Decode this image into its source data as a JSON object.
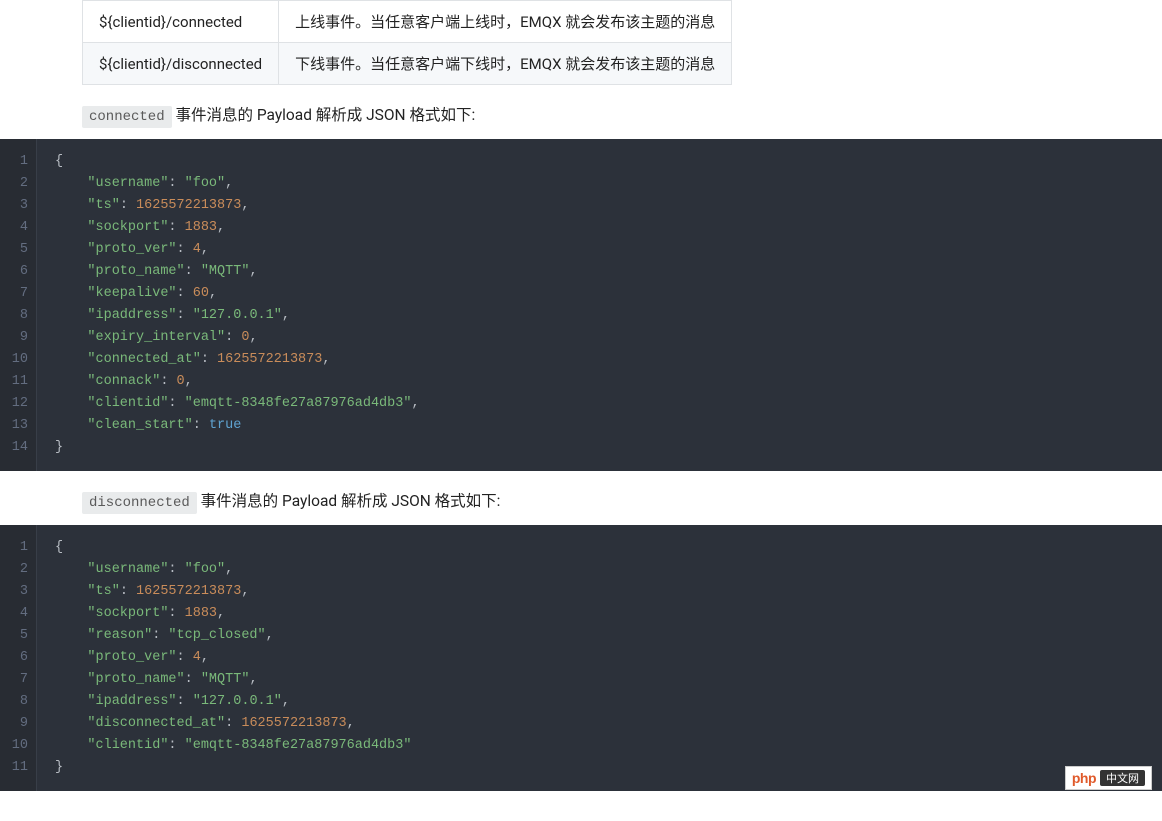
{
  "table": {
    "rows": [
      {
        "topic": "${clientid}/connected",
        "desc": "上线事件。当任意客户端上线时，EMQX 就会发布该主题的消息"
      },
      {
        "topic": "${clientid}/disconnected",
        "desc": "下线事件。当任意客户端下线时，EMQX 就会发布该主题的消息"
      }
    ]
  },
  "section1": {
    "code_label": "connected",
    "text": " 事件消息的 Payload 解析成 JSON 格式如下:"
  },
  "code1": {
    "lines": 14,
    "tokens": [
      [
        [
          "p",
          "{"
        ]
      ],
      [
        [
          "p",
          "    "
        ],
        [
          "k",
          "\"username\""
        ],
        [
          "p",
          ": "
        ],
        [
          "s",
          "\"foo\""
        ],
        [
          "p",
          ","
        ]
      ],
      [
        [
          "p",
          "    "
        ],
        [
          "k",
          "\"ts\""
        ],
        [
          "p",
          ": "
        ],
        [
          "n",
          "1625572213873"
        ],
        [
          "p",
          ","
        ]
      ],
      [
        [
          "p",
          "    "
        ],
        [
          "k",
          "\"sockport\""
        ],
        [
          "p",
          ": "
        ],
        [
          "n",
          "1883"
        ],
        [
          "p",
          ","
        ]
      ],
      [
        [
          "p",
          "    "
        ],
        [
          "k",
          "\"proto_ver\""
        ],
        [
          "p",
          ": "
        ],
        [
          "n",
          "4"
        ],
        [
          "p",
          ","
        ]
      ],
      [
        [
          "p",
          "    "
        ],
        [
          "k",
          "\"proto_name\""
        ],
        [
          "p",
          ": "
        ],
        [
          "s",
          "\"MQTT\""
        ],
        [
          "p",
          ","
        ]
      ],
      [
        [
          "p",
          "    "
        ],
        [
          "k",
          "\"keepalive\""
        ],
        [
          "p",
          ": "
        ],
        [
          "n",
          "60"
        ],
        [
          "p",
          ","
        ]
      ],
      [
        [
          "p",
          "    "
        ],
        [
          "k",
          "\"ipaddress\""
        ],
        [
          "p",
          ": "
        ],
        [
          "s",
          "\"127.0.0.1\""
        ],
        [
          "p",
          ","
        ]
      ],
      [
        [
          "p",
          "    "
        ],
        [
          "k",
          "\"expiry_interval\""
        ],
        [
          "p",
          ": "
        ],
        [
          "n",
          "0"
        ],
        [
          "p",
          ","
        ]
      ],
      [
        [
          "p",
          "    "
        ],
        [
          "k",
          "\"connected_at\""
        ],
        [
          "p",
          ": "
        ],
        [
          "n",
          "1625572213873"
        ],
        [
          "p",
          ","
        ]
      ],
      [
        [
          "p",
          "    "
        ],
        [
          "k",
          "\"connack\""
        ],
        [
          "p",
          ": "
        ],
        [
          "n",
          "0"
        ],
        [
          "p",
          ","
        ]
      ],
      [
        [
          "p",
          "    "
        ],
        [
          "k",
          "\"clientid\""
        ],
        [
          "p",
          ": "
        ],
        [
          "s",
          "\"emqtt-8348fe27a87976ad4db3\""
        ],
        [
          "p",
          ","
        ]
      ],
      [
        [
          "p",
          "    "
        ],
        [
          "k",
          "\"clean_start\""
        ],
        [
          "p",
          ": "
        ],
        [
          "b",
          "true"
        ]
      ],
      [
        [
          "p",
          "}"
        ]
      ]
    ]
  },
  "section2": {
    "code_label": "disconnected",
    "text": " 事件消息的 Payload 解析成 JSON 格式如下:"
  },
  "code2": {
    "lines": 11,
    "tokens": [
      [
        [
          "p",
          "{"
        ]
      ],
      [
        [
          "p",
          "    "
        ],
        [
          "k",
          "\"username\""
        ],
        [
          "p",
          ": "
        ],
        [
          "s",
          "\"foo\""
        ],
        [
          "p",
          ","
        ]
      ],
      [
        [
          "p",
          "    "
        ],
        [
          "k",
          "\"ts\""
        ],
        [
          "p",
          ": "
        ],
        [
          "n",
          "1625572213873"
        ],
        [
          "p",
          ","
        ]
      ],
      [
        [
          "p",
          "    "
        ],
        [
          "k",
          "\"sockport\""
        ],
        [
          "p",
          ": "
        ],
        [
          "n",
          "1883"
        ],
        [
          "p",
          ","
        ]
      ],
      [
        [
          "p",
          "    "
        ],
        [
          "k",
          "\"reason\""
        ],
        [
          "p",
          ": "
        ],
        [
          "s",
          "\"tcp_closed\""
        ],
        [
          "p",
          ","
        ]
      ],
      [
        [
          "p",
          "    "
        ],
        [
          "k",
          "\"proto_ver\""
        ],
        [
          "p",
          ": "
        ],
        [
          "n",
          "4"
        ],
        [
          "p",
          ","
        ]
      ],
      [
        [
          "p",
          "    "
        ],
        [
          "k",
          "\"proto_name\""
        ],
        [
          "p",
          ": "
        ],
        [
          "s",
          "\"MQTT\""
        ],
        [
          "p",
          ","
        ]
      ],
      [
        [
          "p",
          "    "
        ],
        [
          "k",
          "\"ipaddress\""
        ],
        [
          "p",
          ": "
        ],
        [
          "s",
          "\"127.0.0.1\""
        ],
        [
          "p",
          ","
        ]
      ],
      [
        [
          "p",
          "    "
        ],
        [
          "k",
          "\"disconnected_at\""
        ],
        [
          "p",
          ": "
        ],
        [
          "n",
          "1625572213873"
        ],
        [
          "p",
          ","
        ]
      ],
      [
        [
          "p",
          "    "
        ],
        [
          "k",
          "\"clientid\""
        ],
        [
          "p",
          ": "
        ],
        [
          "s",
          "\"emqtt-8348fe27a87976ad4db3\""
        ]
      ],
      [
        [
          "p",
          "}"
        ]
      ]
    ]
  },
  "watermark": {
    "left": "php",
    "right": "中文网"
  }
}
